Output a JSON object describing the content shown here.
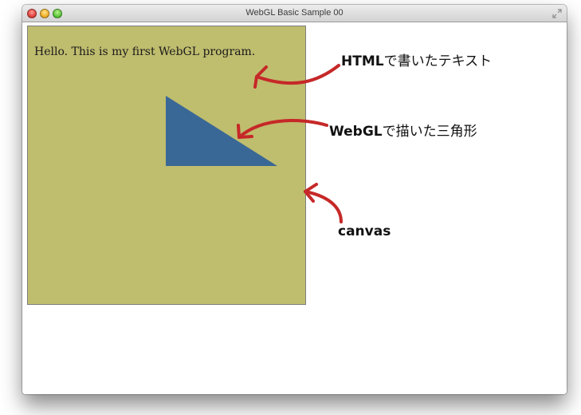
{
  "window": {
    "title": "WebGL Basic Sample 00"
  },
  "canvas": {
    "html_text": "Hello. This is my first WebGL program.",
    "background_color": "#bfbd6e",
    "triangle_color": "#3a6896"
  },
  "annotations": {
    "html_text": {
      "bold": "HTML",
      "rest": "で書いたテキスト"
    },
    "webgl": {
      "bold": "WebGL",
      "rest": "で描いた三角形"
    },
    "canvas": {
      "bold": "canvas",
      "rest": ""
    }
  },
  "arrow_color": "#c62828",
  "icons": [
    "close-icon",
    "minimize-icon",
    "zoom-icon",
    "fullscreen-icon"
  ]
}
